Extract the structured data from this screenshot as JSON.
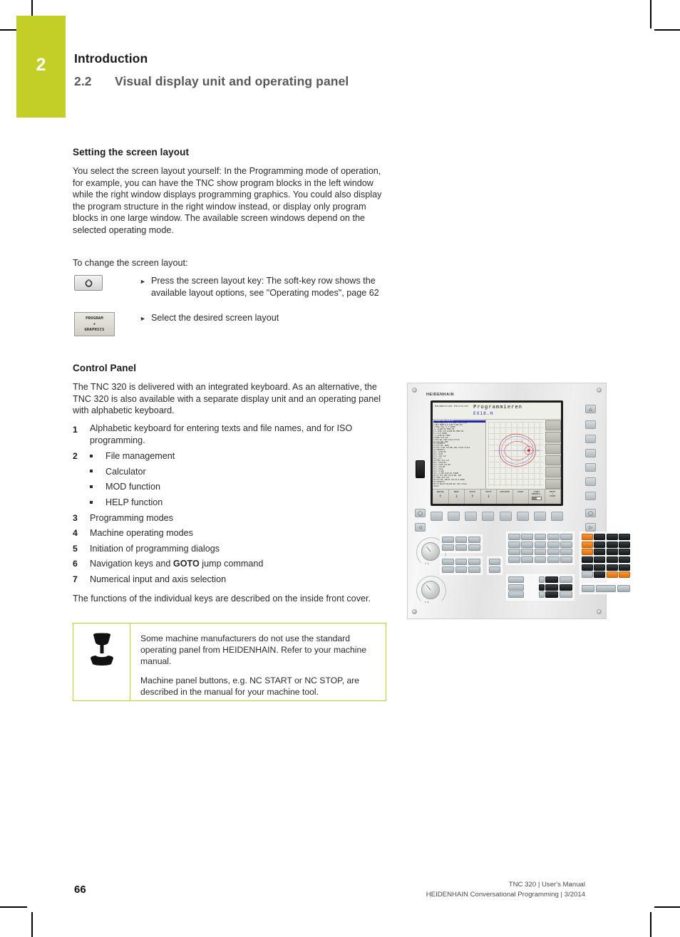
{
  "header": {
    "chapter_number": "2",
    "chapter_title": "Introduction",
    "section_number": "2.2",
    "section_title": "Visual display unit and operating panel",
    "accent_color": "#c3cf26"
  },
  "screen_layout": {
    "heading": "Setting the screen layout",
    "paragraph1": "You select the screen layout yourself: In the Programming mode of operation, for example, you can have the TNC show program blocks in the left window while the right window displays programming graphics. You could also display the program structure in the right window instead, or display only program blocks in one large window. The available screen windows depend on the selected operating mode.",
    "paragraph2": "To change the screen layout:",
    "steps": [
      {
        "key_icon": "screen-layout-key-icon",
        "text": "Press the screen layout key: The soft-key row shows the available layout options, see \"Operating modes\", page 62"
      },
      {
        "softkey_line1": "PROGRAM",
        "softkey_line2": "+",
        "softkey_line3": "GRAPHICS",
        "text": "Select the desired screen layout"
      }
    ]
  },
  "control_panel": {
    "heading": "Control Panel",
    "paragraph1": "The TNC 320 is delivered with an integrated keyboard. As an alternative, the TNC 320 is also available with a separate display unit and an operating panel with alphabetic keyboard.",
    "items": [
      {
        "num": "1",
        "text": "Alphabetic keyboard for entering texts and file names, and for ISO programming."
      },
      {
        "num": "2",
        "text": "",
        "subitems": [
          "File management",
          "Calculator",
          "MOD function",
          "HELP function"
        ]
      },
      {
        "num": "3",
        "text": "Programming modes"
      },
      {
        "num": "4",
        "text": "Machine operating modes"
      },
      {
        "num": "5",
        "text": "Initiation of programming dialogs"
      },
      {
        "num": "6",
        "text_pre": "Navigation keys and ",
        "text_bold": "GOTO",
        "text_post": " jump command"
      },
      {
        "num": "7",
        "text": "Numerical input and axis selection"
      }
    ],
    "paragraph2": "The functions of the individual keys are described on the inside front cover."
  },
  "note": {
    "icon": "machine-tool-icon",
    "paragraph1": "Some machine manufacturers do not use the standard operating panel from HEIDENHAIN. Refer to your machine manual.",
    "paragraph2": "Machine panel buttons, e.g. NC START or NC STOP, are described in the manual for your machine tool.",
    "border_color": "#c3cf26"
  },
  "panel_image": {
    "brand": "HEIDENHAIN",
    "screen": {
      "mode_label": "Handbetrieb  Editieren",
      "title": "Programmieren",
      "file": "EX18.H",
      "program_lines": [
        "0 BEGIN PGM EX18 MM",
        "1  BLK FORM 0.1 Z X-100 Y-80 Z-10",
        "2  BLK FORM 0.2  X+50  Y+80  Z+0",
        "3  TOOL CALL 5 Z S3000",
        "4  L  Z+100 R0 FMAX M3",
        "5  L  X+50  Y+0  Z+100 R0 FMAX M3",
        "6  L  Z-5 F2000",
        "7  L  X+50 RL F500",
        "8  FPOL X+0 Y+0",
        "9  FCT DR- R40  CCX+0  CCY+0",
        "10 FCT DR+ R20",
        "11 FSELECT3",
        "12 FCT DR- R210",
        "13 FCT  C+45  Y+0 DR+ R41  CCX+0  CCY+0",
        "14 FSELECT1",
        "15 L  Z+50 R0",
        "16 L  Z+10",
        "17 L  X+0  Y+0",
        "18 L  Z-5",
        "19 FPOL X+0 Y+0",
        "20 L  X+10 R0",
        "21 C  X+10  Y+0 DR-",
        "22 L  X+0 R0",
        "23 L  Z+10",
        "24 L  X-100",
        "25 L  X-100 Z+10 RL F1000",
        "26 FC  CCX-100  CCY+0 DR- DR7",
        "27 FPOL  X+0  Y+0",
        "28 FCT DR- R0+41  CCX-34.5 R398",
        "29 FSELECT1",
        "30 FC  PD+41  PA+100 DR- RX1  CCX+0",
        "   CCX+0"
      ],
      "softkeys": [
        {
          "l1": "ANFANG",
          "arrow": "up"
        },
        {
          "l1": "ENDE",
          "arrow": "down"
        },
        {
          "l1": "SEITE",
          "arrow": "up"
        },
        {
          "l1": "SEITE",
          "arrow": "down"
        },
        {
          "l1": "LOESCHEN"
        },
        {
          "l1": "START"
        },
        {
          "l1": "START",
          "l2": "EINZELS.",
          "toggle": true
        },
        {
          "l1": "RESET",
          "l2": "+",
          "l3": "START"
        }
      ]
    }
  },
  "footer": {
    "page_number": "66",
    "line1": "TNC 320 | User's Manual",
    "line2": "HEIDENHAIN Conversational Programming | 3/2014"
  }
}
